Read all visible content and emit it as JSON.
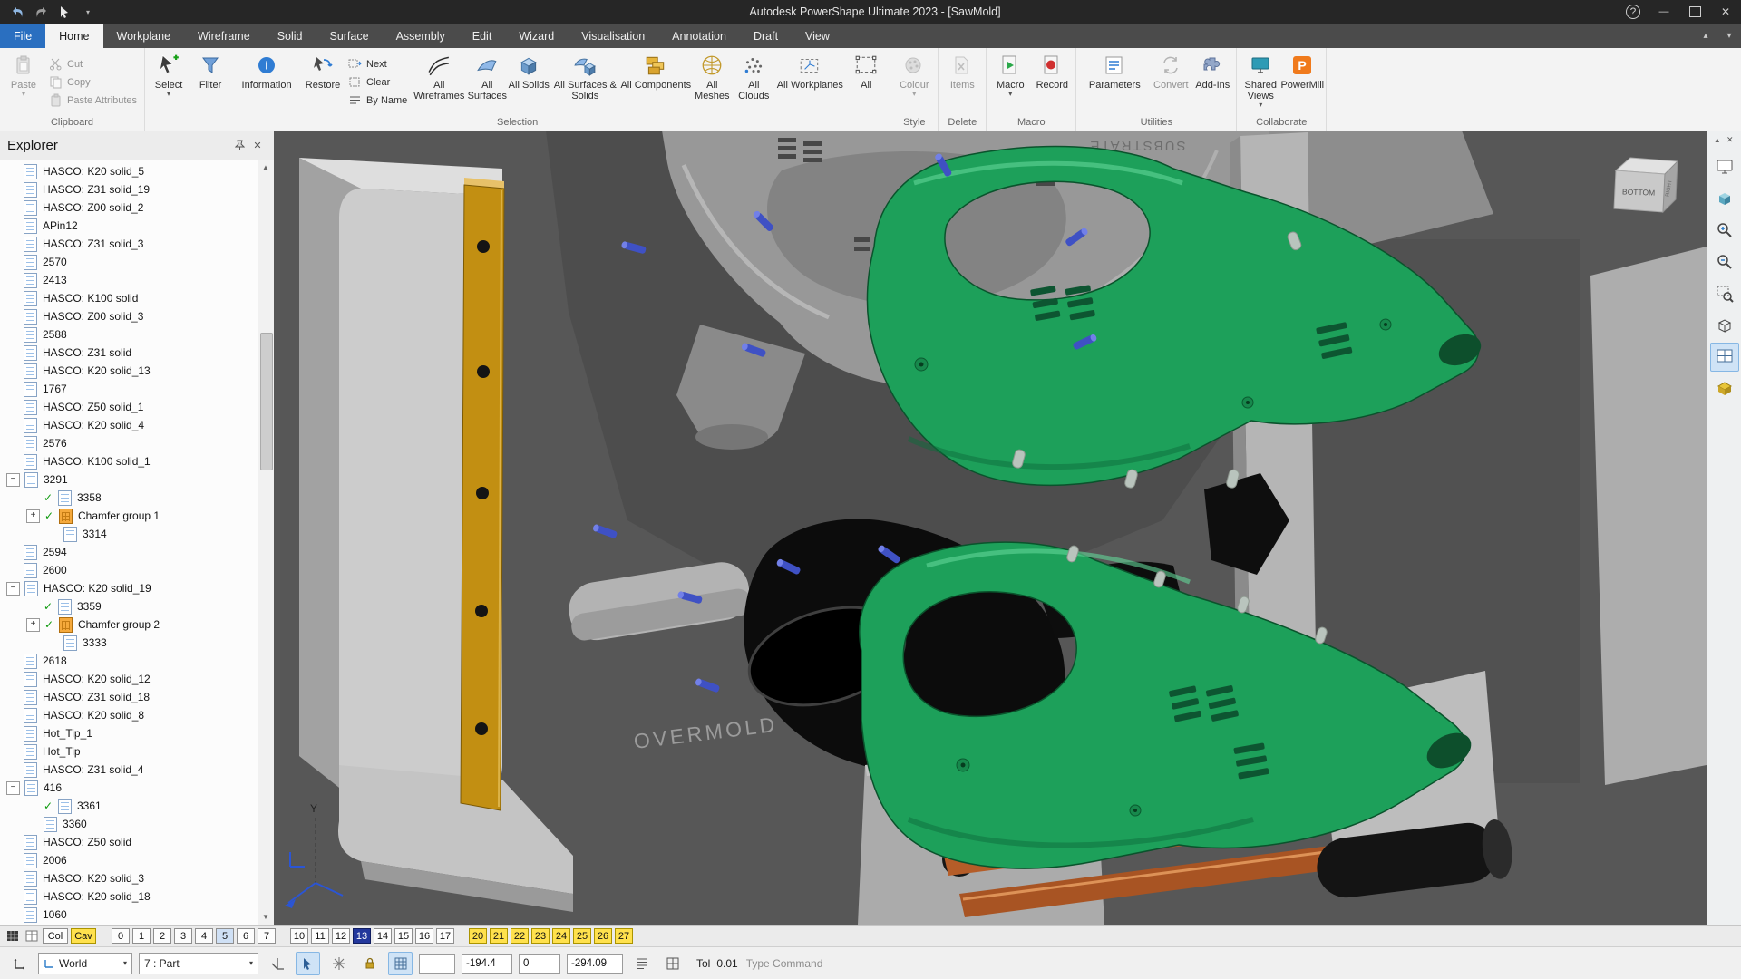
{
  "window": {
    "title": "Autodesk PowerShape Ultimate 2023 - [SawMold]"
  },
  "menu": {
    "tabs": [
      {
        "label": "File",
        "cls": "file"
      },
      {
        "label": "Home",
        "cls": "active"
      },
      {
        "label": "Workplane"
      },
      {
        "label": "Wireframe"
      },
      {
        "label": "Solid"
      },
      {
        "label": "Surface"
      },
      {
        "label": "Assembly"
      },
      {
        "label": "Edit"
      },
      {
        "label": "Wizard"
      },
      {
        "label": "Visualisation"
      },
      {
        "label": "Annotation"
      },
      {
        "label": "Draft"
      },
      {
        "label": "View"
      }
    ]
  },
  "ribbon": {
    "groups": [
      "Clipboard",
      "Selection",
      "Style",
      "Delete",
      "Macro",
      "Utilities",
      "Collaborate"
    ],
    "clipboard": {
      "paste": "Paste",
      "cut": "Cut",
      "copy": "Copy",
      "paste_attributes": "Paste Attributes"
    },
    "selection": {
      "select": "Select",
      "filter": "Filter",
      "information": "Information",
      "restore": "Restore",
      "next": "Next",
      "clear": "Clear",
      "by_name": "By Name",
      "all_wireframes": "All Wireframes",
      "all_surfaces": "All Surfaces",
      "all_solids": "All Solids",
      "all_surfaces_solids": "All Surfaces & Solids",
      "all_components": "All Components",
      "all_meshes": "All Meshes",
      "all_clouds": "All Clouds",
      "all_workplanes": "All Workplanes",
      "all": "All"
    },
    "style": {
      "colour": "Colour"
    },
    "delete": {
      "items": "Items"
    },
    "macro": {
      "macro": "Macro",
      "record": "Record"
    },
    "utilities": {
      "parameters": "Parameters",
      "convert": "Convert",
      "add_ins": "Add-Ins"
    },
    "collaborate": {
      "shared_views": "Shared Views",
      "powermill": "PowerMill"
    }
  },
  "explorer": {
    "title": "Explorer",
    "items": [
      {
        "label": "HASCO: K20 solid_5",
        "cls": "lvl0"
      },
      {
        "label": "HASCO: Z31 solid_19",
        "cls": "lvl0"
      },
      {
        "label": "HASCO: Z00 solid_2",
        "cls": "lvl0"
      },
      {
        "label": "APin12",
        "cls": "lvl0"
      },
      {
        "label": "HASCO: Z31 solid_3",
        "cls": "lvl0"
      },
      {
        "label": "2570",
        "cls": "lvl0"
      },
      {
        "label": "2413",
        "cls": "lvl0"
      },
      {
        "label": "HASCO: K100 solid",
        "cls": "lvl0"
      },
      {
        "label": "HASCO: Z00 solid_3",
        "cls": "lvl0"
      },
      {
        "label": "2588",
        "cls": "lvl0"
      },
      {
        "label": "HASCO: Z31 solid",
        "cls": "lvl0"
      },
      {
        "label": "HASCO: K20 solid_13",
        "cls": "lvl0"
      },
      {
        "label": "1767",
        "cls": "lvl0"
      },
      {
        "label": "HASCO: Z50 solid_1",
        "cls": "lvl0"
      },
      {
        "label": "HASCO: K20 solid_4",
        "cls": "lvl0"
      },
      {
        "label": "2576",
        "cls": "lvl0"
      },
      {
        "label": "HASCO: K100 solid_1",
        "cls": "lvl0"
      },
      {
        "label": "3291",
        "cls": "lvl0 exp-minus"
      },
      {
        "label": "3358",
        "cls": "lvl1 chk"
      },
      {
        "label": "Chamfer group 1",
        "cls": "lvl1 chk exp-plus ic-group"
      },
      {
        "label": "3314",
        "cls": "lvl2"
      },
      {
        "label": "2594",
        "cls": "lvl0"
      },
      {
        "label": "2600",
        "cls": "lvl0"
      },
      {
        "label": "HASCO: K20 solid_19",
        "cls": "lvl0 exp-minus"
      },
      {
        "label": "3359",
        "cls": "lvl1 chk"
      },
      {
        "label": "Chamfer group 2",
        "cls": "lvl1 chk exp-plus ic-group"
      },
      {
        "label": "3333",
        "cls": "lvl2"
      },
      {
        "label": "2618",
        "cls": "lvl0"
      },
      {
        "label": "HASCO: K20 solid_12",
        "cls": "lvl0"
      },
      {
        "label": "HASCO: Z31 solid_18",
        "cls": "lvl0"
      },
      {
        "label": "HASCO: K20 solid_8",
        "cls": "lvl0"
      },
      {
        "label": "Hot_Tip_1",
        "cls": "lvl0"
      },
      {
        "label": "Hot_Tip",
        "cls": "lvl0"
      },
      {
        "label": "HASCO: Z31 solid_4",
        "cls": "lvl0"
      },
      {
        "label": "416",
        "cls": "lvl0 exp-minus"
      },
      {
        "label": "3361",
        "cls": "lvl1 chk"
      },
      {
        "label": "3360",
        "cls": "lvl1"
      },
      {
        "label": "HASCO: Z50 solid",
        "cls": "lvl0"
      },
      {
        "label": "2006",
        "cls": "lvl0"
      },
      {
        "label": "HASCO: K20 solid_3",
        "cls": "lvl0"
      },
      {
        "label": "HASCO: K20 solid_18",
        "cls": "lvl0"
      },
      {
        "label": "1060",
        "cls": "lvl0"
      }
    ]
  },
  "viewport": {
    "labels": {
      "overmold": "OVERMOLD",
      "substrate": "SUBSTRATE",
      "cube_front": "BOTTOM",
      "cube_side": "RIGHT",
      "axis_y": "Y"
    }
  },
  "levels": {
    "col": "Col",
    "cav": "Cav",
    "buttons": [
      {
        "label": "0"
      },
      {
        "label": "1"
      },
      {
        "label": "2"
      },
      {
        "label": "3"
      },
      {
        "label": "4"
      },
      {
        "label": "5",
        "cls": "lt"
      },
      {
        "label": "6"
      },
      {
        "label": "7",
        "cls": "gap"
      },
      {
        "label": "10"
      },
      {
        "label": "11"
      },
      {
        "label": "12"
      },
      {
        "label": "13",
        "cls": "sel"
      },
      {
        "label": "14"
      },
      {
        "label": "15"
      },
      {
        "label": "16"
      },
      {
        "label": "17",
        "cls": "gap"
      },
      {
        "label": "20",
        "cls": "yel"
      },
      {
        "label": "21",
        "cls": "yel"
      },
      {
        "label": "22",
        "cls": "yel"
      },
      {
        "label": "23",
        "cls": "yel"
      },
      {
        "label": "24",
        "cls": "yel"
      },
      {
        "label": "25",
        "cls": "yel"
      },
      {
        "label": "26",
        "cls": "yel"
      },
      {
        "label": "27",
        "cls": "yel"
      }
    ]
  },
  "status": {
    "world": "World",
    "part": "7 : Part",
    "coord_x": "-194.4",
    "coord_y": "0",
    "coord_z": "-294.09",
    "tol_label": "Tol",
    "tol_value": "0.01",
    "command_placeholder": "Type Command"
  },
  "icons": {
    "info_glyph": "i",
    "powermill_glyph": "P"
  }
}
